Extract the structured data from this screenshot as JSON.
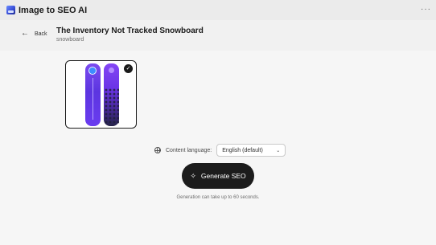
{
  "app": {
    "title": "Image to SEO AI",
    "more_label": "···"
  },
  "header": {
    "back_label": "Back",
    "back_arrow": "←",
    "product_title": "The Inventory Not Tracked Snowboard",
    "product_subtitle": "snowboard"
  },
  "content": {
    "image_selected_mark": "✓",
    "language": {
      "label": "Content language:",
      "selected": "English (default)",
      "chevron": "⌄"
    },
    "generate": {
      "icon": "✧",
      "label": "Generate SEO"
    },
    "hint": "Generation can take up to 60 seconds."
  },
  "colors": {
    "primary_button": "#1c1c1c",
    "page_background": "#f1f1f1",
    "board_purple": "#6a3cf0"
  }
}
